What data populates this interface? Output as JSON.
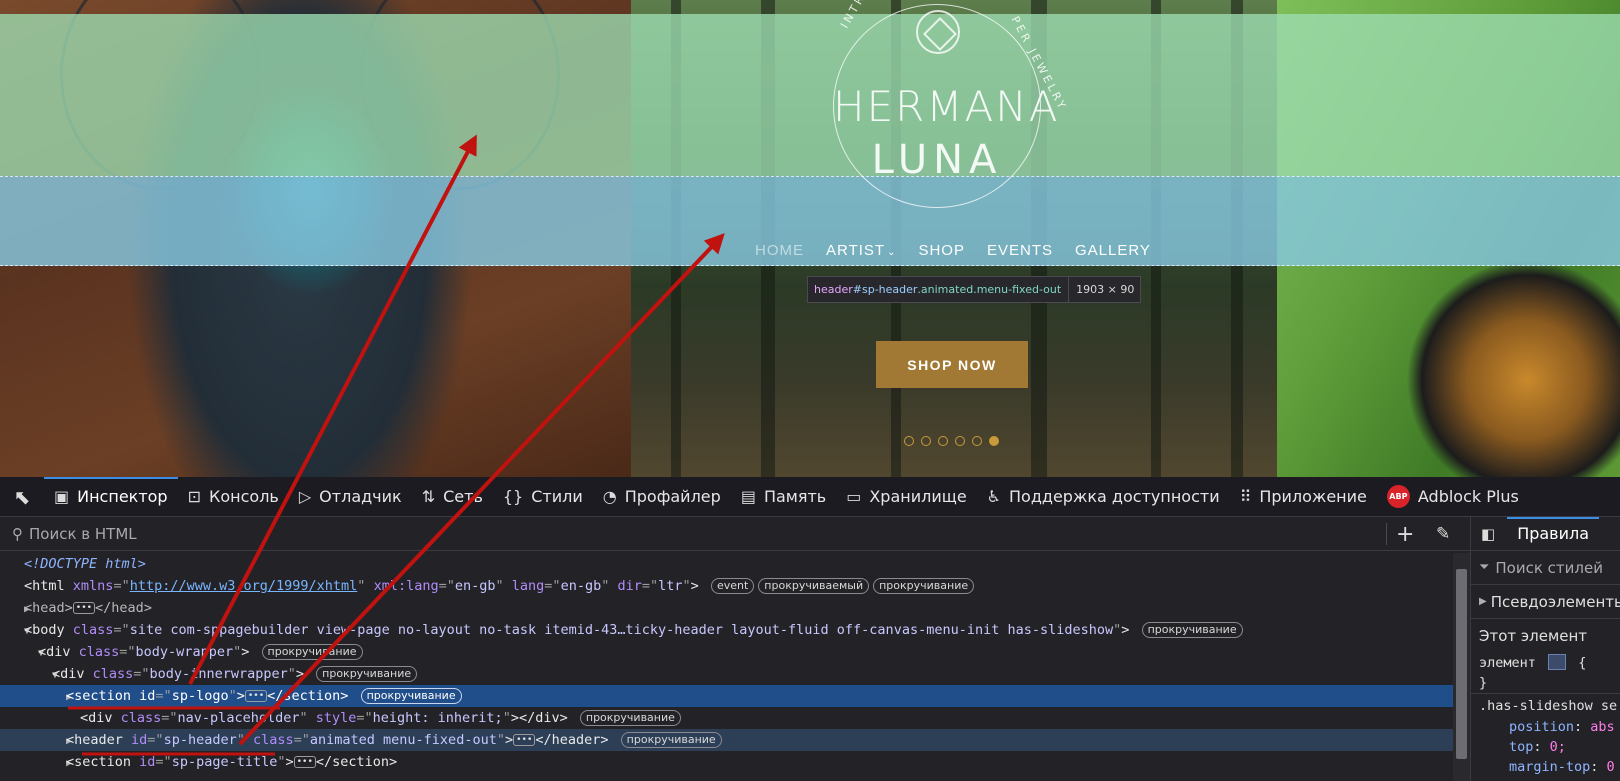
{
  "website": {
    "logo": {
      "arc_left": "INTRICATE HA",
      "arc_right": "PER JEWELRY",
      "name_line1": "HERMANA",
      "name_line2": "LUNA"
    },
    "nav": {
      "items": [
        {
          "label": "HOME"
        },
        {
          "label": "ARTIST"
        },
        {
          "label": "SHOP"
        },
        {
          "label": "EVENTS"
        },
        {
          "label": "GALLERY"
        }
      ],
      "artist_chevron": "⌄"
    },
    "tooltip": {
      "tag": "header",
      "id": "#sp-header",
      "classes": ".animated.menu-fixed-out",
      "size": "1903 × 90"
    },
    "cta": {
      "label": "SHOP NOW"
    },
    "slider": {
      "count": 6,
      "active_index": 5,
      "dot_color": "#c89a3c"
    }
  },
  "devtools": {
    "tabs": [
      {
        "label": "Инспектор",
        "icon": "inspector-icon"
      },
      {
        "label": "Консоль",
        "icon": "console-icon"
      },
      {
        "label": "Отладчик",
        "icon": "debugger-icon"
      },
      {
        "label": "Сеть",
        "icon": "network-icon"
      },
      {
        "label": "Стили",
        "icon": "style-editor-icon"
      },
      {
        "label": "Профайлер",
        "icon": "profiler-icon"
      },
      {
        "label": "Память",
        "icon": "memory-icon"
      },
      {
        "label": "Хранилище",
        "icon": "storage-icon"
      },
      {
        "label": "Поддержка доступности",
        "icon": "accessibility-icon"
      },
      {
        "label": "Приложение",
        "icon": "application-icon"
      },
      {
        "label": "Adblock Plus",
        "icon": "abp-icon"
      }
    ],
    "abp_badge": "ABP",
    "accent_color": "#3b8de6",
    "search": {
      "placeholder": "Поиск в HTML"
    },
    "tree": {
      "doctype": "<!DOCTYPE html>",
      "html": {
        "tag": "html",
        "attrs": [
          {
            "name": "xmlns",
            "value": "http://www.w3.org/1999/xhtml"
          },
          {
            "name": "xml:lang",
            "value": "en-gb"
          },
          {
            "name": "lang",
            "value": "en-gb"
          },
          {
            "name": "dir",
            "value": "ltr"
          }
        ],
        "badges": [
          "event",
          "прокручиваемый",
          "прокручивание"
        ]
      },
      "head": {
        "open": "<head>",
        "close": "</head>"
      },
      "body": {
        "class": "site com-sppagebuilder view-page no-layout no-task itemid-43…ticky-header layout-fluid off-canvas-menu-init has-slideshow",
        "badge": "прокручивание"
      },
      "body_wrapper": {
        "class": "body-wrapper",
        "badge": "прокручивание"
      },
      "body_inner": {
        "class": "body-innerwrapper",
        "badge": "прокручивание"
      },
      "sp_logo": {
        "id": "sp-logo",
        "badge": "прокручивание"
      },
      "nav_placeholder": {
        "class": "nav-placeholder",
        "style": "height: inherit;",
        "badge": "прокручивание"
      },
      "sp_header": {
        "id": "sp-header",
        "class": "animated menu-fixed-out",
        "badge": "прокручивание"
      },
      "sp_page_title": {
        "id": "sp-page-title"
      }
    },
    "rules": {
      "tab_label": "Правила",
      "filter_placeholder": "Поиск стилей",
      "pseudo": "Псевдоэлементы",
      "this_element": "Этот элемент",
      "element_label": "элемент",
      "brace_open": "{",
      "brace_close": "}",
      "selector": ".has-slideshow se",
      "props": [
        {
          "name": "position",
          "value": "abs"
        },
        {
          "name": "top",
          "value": "0;"
        },
        {
          "name": "margin-top",
          "value": "0"
        }
      ]
    }
  },
  "annotation": {
    "arrow_color": "#c0120f"
  }
}
